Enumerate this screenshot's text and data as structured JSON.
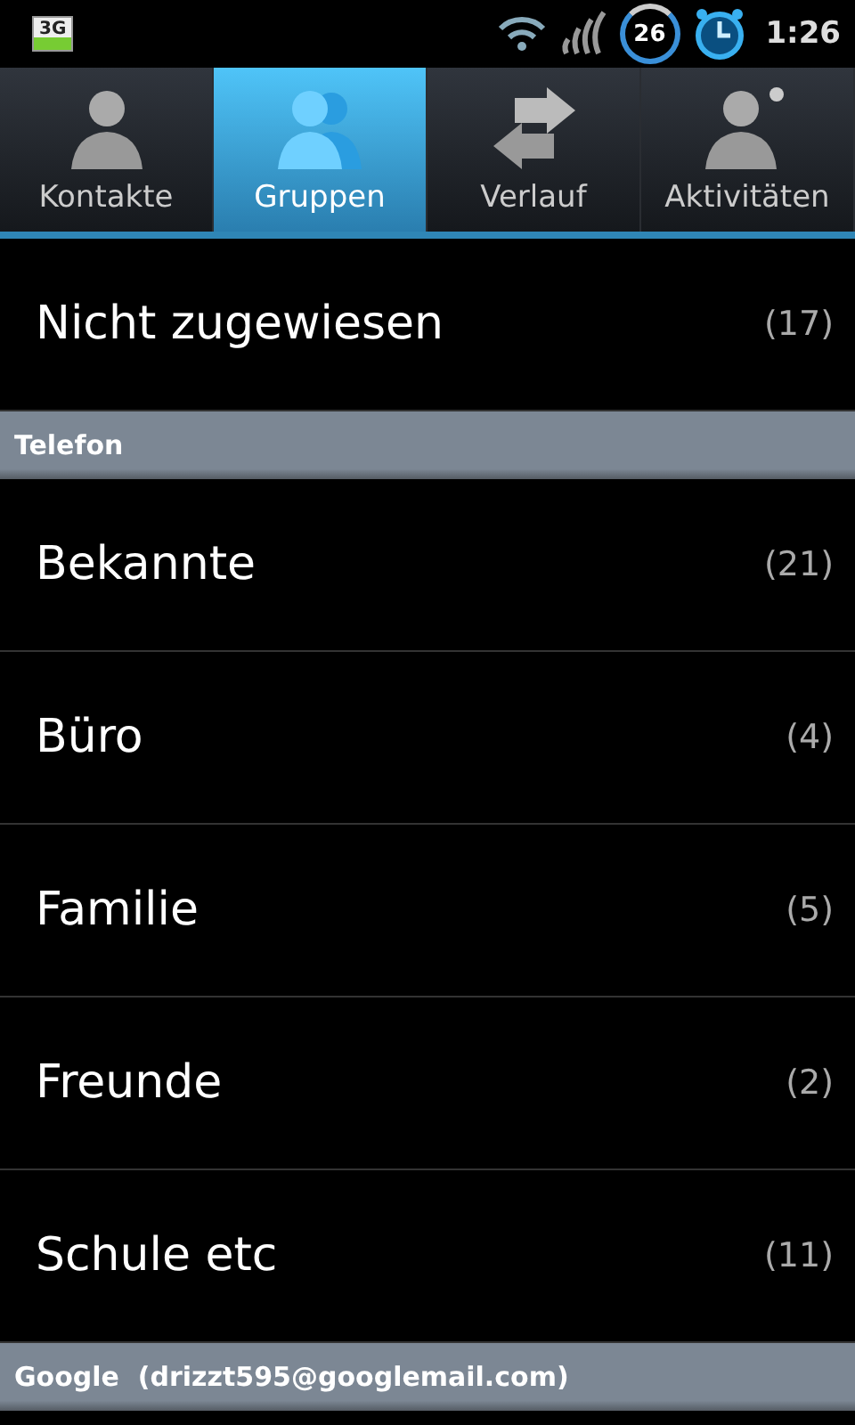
{
  "status_bar": {
    "network": "3G",
    "badge": "26",
    "time": "1:26"
  },
  "tabs": [
    {
      "label": "Kontakte",
      "kind": "person",
      "selected": false
    },
    {
      "label": "Gruppen",
      "kind": "group",
      "selected": true
    },
    {
      "label": "Verlauf",
      "kind": "arrows",
      "selected": false
    },
    {
      "label": "Aktivitäten",
      "kind": "activity",
      "selected": false
    }
  ],
  "sections": [
    {
      "items": [
        {
          "name": "Nicht zugewiesen",
          "count": "(17)"
        }
      ]
    },
    {
      "header": "Telefon",
      "items": [
        {
          "name": "Bekannte",
          "count": "(21)"
        },
        {
          "name": "Büro",
          "count": "(4)"
        },
        {
          "name": "Familie",
          "count": "(5)"
        },
        {
          "name": "Freunde",
          "count": "(2)"
        },
        {
          "name": "Schule etc",
          "count": "(11)"
        }
      ]
    },
    {
      "header": "Google  (drizzt595@googlemail.com)"
    }
  ]
}
